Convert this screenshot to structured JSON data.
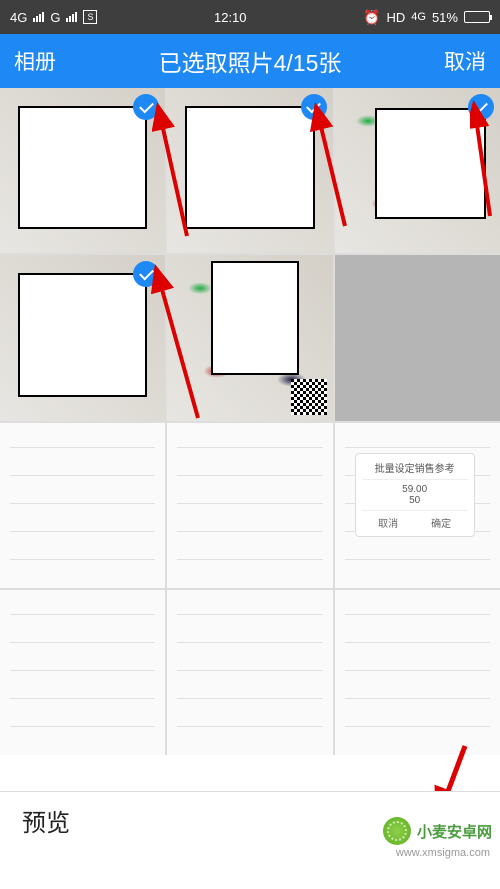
{
  "statusbar": {
    "net1": "4G",
    "net2": "G",
    "time": "12:10",
    "hd": "HD",
    "net3": "4G",
    "battery_pct": "51%"
  },
  "nav": {
    "left": "相册",
    "title": "已选取照片4/15张",
    "right": "取消"
  },
  "selection": {
    "selected": 4,
    "max": 15
  },
  "grid": {
    "items": [
      {
        "id": 0,
        "kind": "shoes",
        "selected": true,
        "overlay": true
      },
      {
        "id": 1,
        "kind": "shoes",
        "selected": true,
        "overlay": true
      },
      {
        "id": 2,
        "kind": "shoes",
        "selected": true,
        "overlay": true
      },
      {
        "id": 3,
        "kind": "shoes",
        "selected": true,
        "overlay": true
      },
      {
        "id": 4,
        "kind": "shoes",
        "selected": false,
        "overlay": true,
        "qr": true
      },
      {
        "id": 5,
        "kind": "gray",
        "selected": false
      },
      {
        "id": 6,
        "kind": "form",
        "selected": false
      },
      {
        "id": 7,
        "kind": "form",
        "selected": false
      },
      {
        "id": 8,
        "kind": "form",
        "selected": false,
        "modal": {
          "title": "批量设定销售参考",
          "price": "59.00",
          "qty": "50",
          "cancel": "取消",
          "confirm": "确定"
        }
      },
      {
        "id": 9,
        "kind": "form",
        "selected": false
      },
      {
        "id": 10,
        "kind": "form",
        "selected": false
      },
      {
        "id": 11,
        "kind": "form",
        "selected": false
      }
    ]
  },
  "bottom": {
    "preview": "预览"
  },
  "watermark": {
    "name": "小麦安卓网",
    "url": "www.xmsigma.com"
  }
}
